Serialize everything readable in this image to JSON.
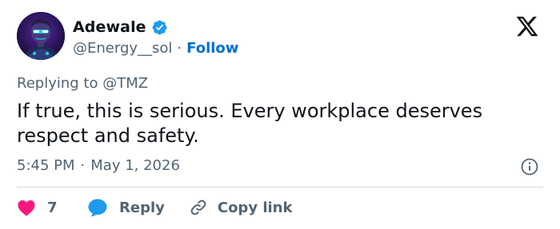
{
  "author": {
    "display_name": "Adewale",
    "handle": "@Energy__sol",
    "separator": "·",
    "follow_label": "Follow",
    "avatar_icon": "avatar-robot-icon",
    "verified_icon": "verified-badge-icon"
  },
  "reply_context": {
    "prefix": "Replying to",
    "mention": "@TMZ"
  },
  "tweet": {
    "text": "If true, this is serious. Every workplace deserves respect and safety.",
    "time": "5:45 PM",
    "separator": "·",
    "date": "May 1, 2026"
  },
  "actions": {
    "like_count": "7",
    "reply_label": "Reply",
    "copy_label": "Copy link"
  },
  "colors": {
    "accent": "#1d9bf0",
    "follow": "#006fd6",
    "like": "#f91880",
    "secondary_text": "#536471",
    "primary_text": "#0f1419",
    "divider": "#cfd9de"
  }
}
